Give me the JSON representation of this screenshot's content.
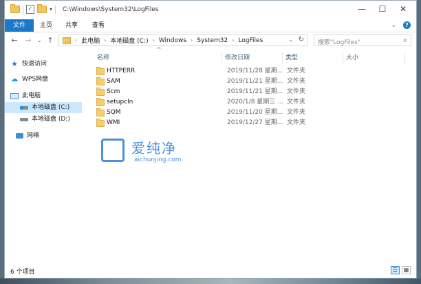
{
  "window": {
    "title_path": "C:\\Windows\\System32\\LogFiles",
    "controls": [
      "—",
      "☐",
      "✕"
    ]
  },
  "quick_access": {
    "check_glyph": "✓",
    "dropdown_glyph": "▾"
  },
  "ribbon": {
    "tabs": [
      "文件",
      "主页",
      "共享",
      "查看"
    ],
    "expand_glyph": "⌄",
    "help_glyph": "?"
  },
  "nav": {
    "back_glyph": "←",
    "forward_glyph": "→",
    "recent_glyph": "⌄",
    "up_glyph": "↑",
    "crumbs": [
      "此电脑",
      "本地磁盘 (C:)",
      "Windows",
      "System32",
      "LogFiles"
    ],
    "crumb_sep": "›",
    "dropdown_glyph": "⌄",
    "refresh_glyph": "↻",
    "search_placeholder": "搜索\"LogFiles\"",
    "search_glyph": "⌕"
  },
  "sidebar": {
    "items": [
      {
        "label": "快速访问",
        "icon": "star-icon",
        "glyph": "★"
      },
      {
        "label": "WPS网盘",
        "icon": "cloud-icon",
        "glyph": "☁"
      },
      {
        "label": "此电脑",
        "icon": "pc-icon"
      },
      {
        "label": "本地磁盘 (C:)",
        "icon": "drive-icon"
      },
      {
        "label": "本地磁盘 (D:)",
        "icon": "drive-icon"
      },
      {
        "label": "网络",
        "icon": "network-icon"
      }
    ]
  },
  "columns": [
    "名称",
    "修改日期",
    "类型",
    "大小"
  ],
  "sort_indicator": "^",
  "files": [
    {
      "name": "HTTPERR",
      "date": "2019/11/28 星期...",
      "type": "文件夹"
    },
    {
      "name": "SAM",
      "date": "2019/11/21 星期...",
      "type": "文件夹"
    },
    {
      "name": "Scm",
      "date": "2019/11/21 星期...",
      "type": "文件夹"
    },
    {
      "name": "setupcln",
      "date": "2020/1/8 星期三 ...",
      "type": "文件夹"
    },
    {
      "name": "SQM",
      "date": "2019/11/20 星期...",
      "type": "文件夹"
    },
    {
      "name": "WMI",
      "date": "2019/12/27 星期...",
      "type": "文件夹"
    }
  ],
  "watermark": {
    "title": "爱纯净",
    "domain": "aichunjing.com"
  },
  "status": {
    "item_count": "6 个项目"
  },
  "view_icons": [
    "☰",
    "▦"
  ]
}
